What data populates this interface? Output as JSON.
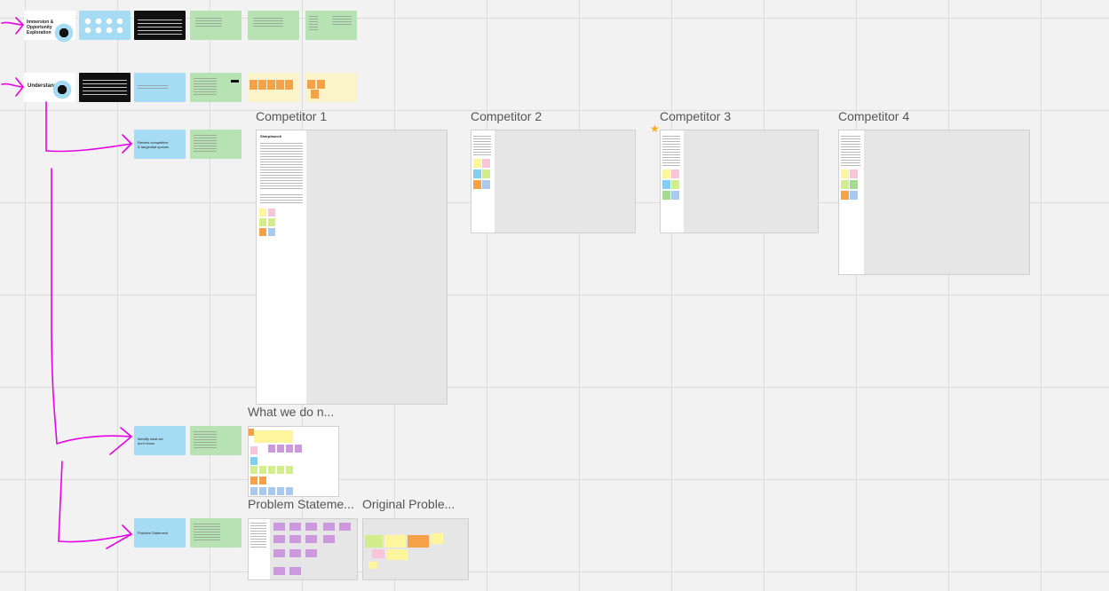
{
  "frames": {
    "competitor_1": "Competitor 1",
    "competitor_2": "Competitor 2",
    "competitor_3": "Competitor 3",
    "competitor_4": "Competitor 4",
    "what_we_do": "What we do n...",
    "problem_statement": "Problem Stateme...",
    "original_problem": "Original Proble..."
  },
  "competitor_1_panel": {
    "heading": "Sharplaunch"
  },
  "row1_cards": {
    "intro_title": "Immersion & Opportunity Exploration"
  },
  "row2_cards": {
    "understand_title": "Understand"
  },
  "row3_cards": {
    "competitive_title": "Review competitive & tangential spaces"
  },
  "row4_cards": {
    "users_title": "Identify what we don't know"
  },
  "row5_cards": {
    "problem_title": "Problem Statement"
  },
  "colors": {
    "connector": "#e600e6",
    "card_blue": "#a6dcf3",
    "card_green": "#b6e2b4",
    "card_cream": "#fbf3c9",
    "frame_bg": "#e6e6e6"
  }
}
